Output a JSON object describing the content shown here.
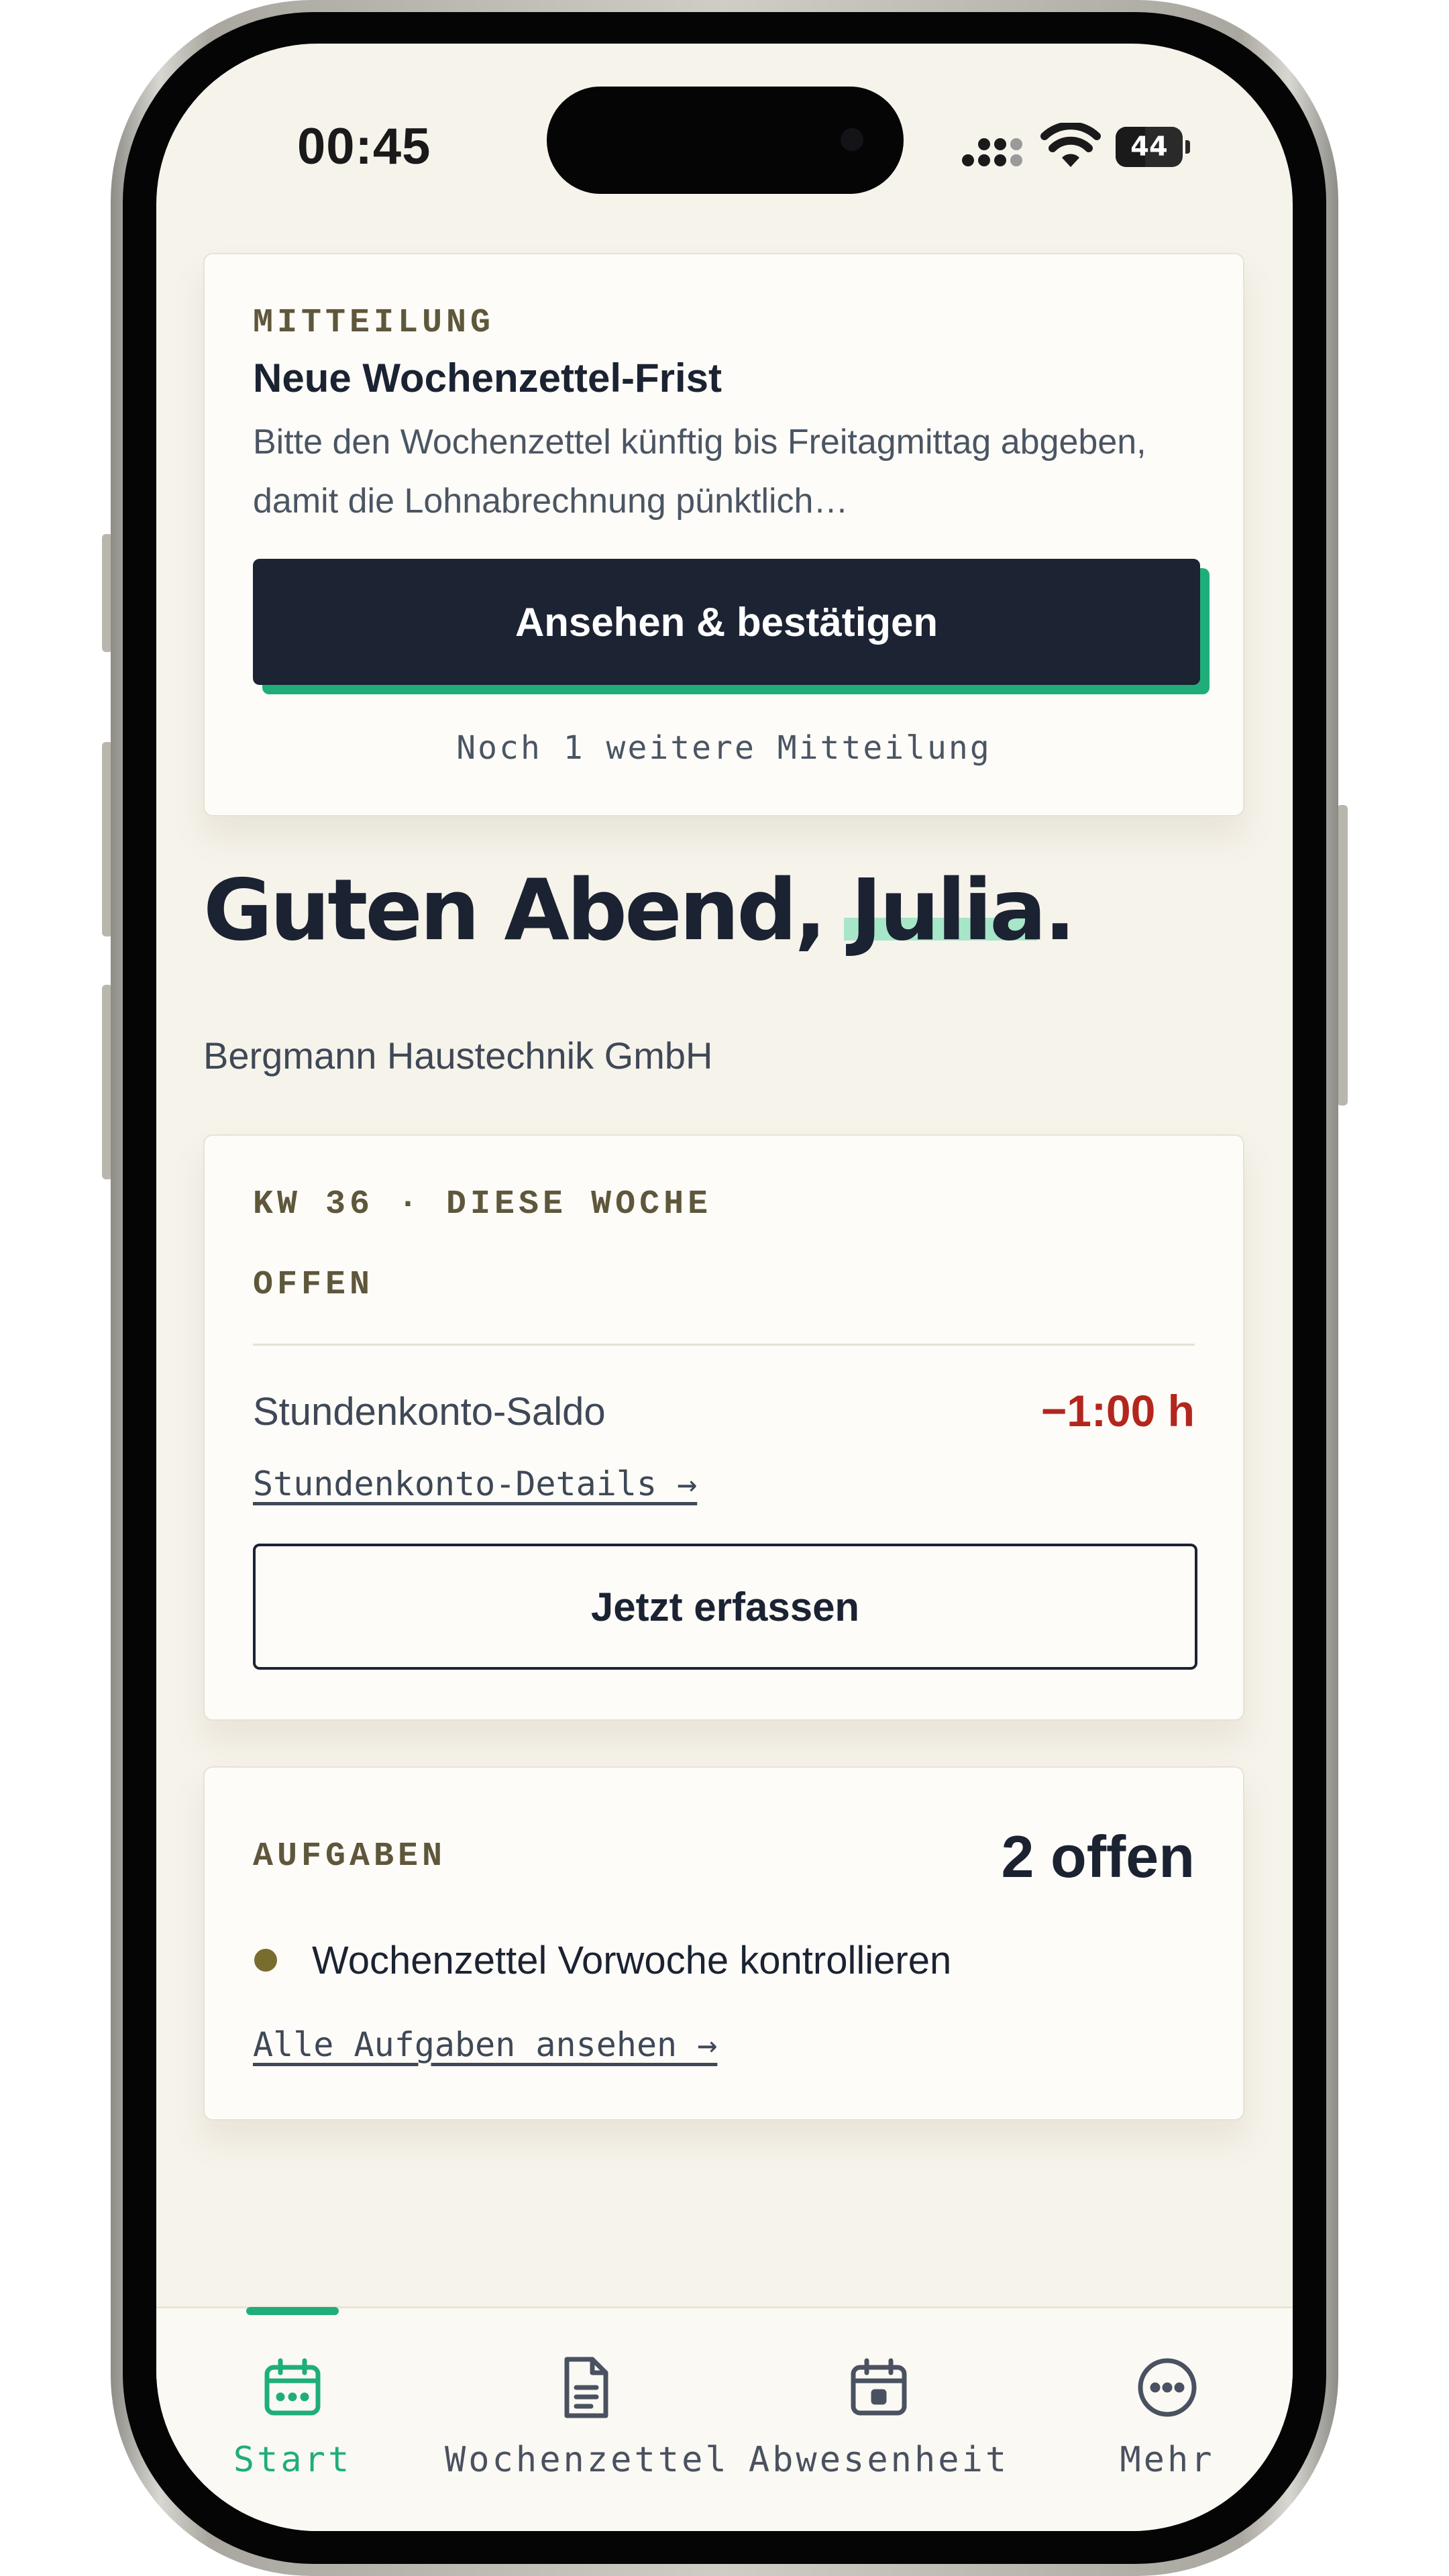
{
  "status_bar": {
    "time": "00:45",
    "battery": "44",
    "battery_percent": 44,
    "icons": [
      "cellular-signal-icon",
      "wifi-icon",
      "battery-icon"
    ]
  },
  "notice": {
    "eyebrow": "MITTEILUNG",
    "title": "Neue Wochenzettel-Frist",
    "body": "Bitte den Wochenzettel künftig bis Freitagmittag abgeben, damit die Lohnabrechnung pünktlich…",
    "button_label": "Ansehen & bestätigen",
    "more": "Noch 1 weitere Mitteilung"
  },
  "greeting": {
    "prefix": "Guten Abend, ",
    "name": "Julia",
    "suffix": "."
  },
  "company": "Bergmann Haustechnik GmbH",
  "week": {
    "eyebrow": "KW 36 · DIESE WOCHE",
    "status": "OFFEN",
    "saldo_label": "Stundenkonto-Saldo",
    "saldo_value": "−1:00 h",
    "details_link": "Stundenkonto-Details →",
    "button_label": "Jetzt erfassen"
  },
  "tasks": {
    "eyebrow": "AUFGABEN",
    "count": "2 offen",
    "items": [
      {
        "label": "Wochenzettel Vorwoche kontrollieren"
      }
    ],
    "all_link": "Alle Aufgaben ansehen →"
  },
  "tabs": [
    {
      "label": "Start",
      "icon": "calendar-icon",
      "active": true
    },
    {
      "label": "Wochenzettel",
      "icon": "document-icon",
      "active": false
    },
    {
      "label": "Abwesenheit",
      "icon": "calendar-event-icon",
      "active": false
    },
    {
      "label": "Mehr",
      "icon": "more-circle-icon",
      "active": false
    }
  ],
  "colors": {
    "accent": "#1fae7a",
    "navy": "#1c2333",
    "negative": "#b3261e",
    "background": "#f6f3eb"
  }
}
